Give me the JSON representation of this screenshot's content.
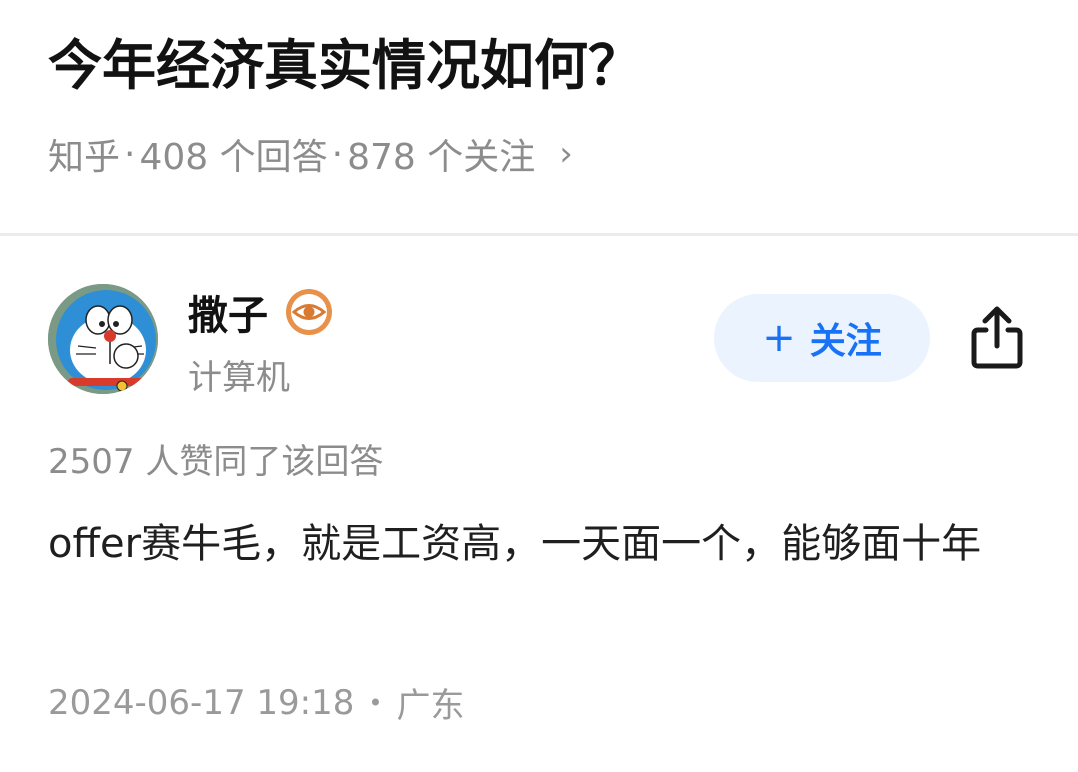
{
  "question": {
    "title": "今年经济真实情况如何？",
    "source": "知乎",
    "answers": "408 个回答",
    "followers": "878 个关注"
  },
  "author": {
    "name": "撒子",
    "bio": "计算机",
    "avatar_icon": "doraemon-avatar",
    "badge_icon": "eye-badge-icon",
    "follow_label": "关注",
    "follow_color": "#1772f6",
    "follow_bg": "#ebf3fe"
  },
  "answer": {
    "votes": "2507 人赞同了该回答",
    "content": "offer赛牛毛，就是工资高，一天面一个，能够面十年",
    "date": "2024-06-17 19:18",
    "location": "广东"
  },
  "icons": {
    "share": "share-icon",
    "chevron": "chevron-right-icon"
  }
}
